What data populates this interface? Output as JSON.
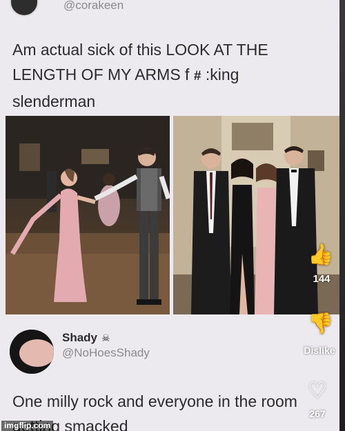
{
  "tweet1": {
    "handle": "@corakeen",
    "line1": "Am actual sick of this LOOK AT THE",
    "line2_a": "LENGTH OF MY ARMS f",
    "line2_hash": "#",
    "line2_b": ":king",
    "line3": "slenderman"
  },
  "side_actions": {
    "like_icon": "thumbs-up-icon",
    "like_count": "144",
    "dislike_icon": "thumbs-down-icon",
    "dislike_label": "Dislike",
    "heart_icon": "heart-icon",
    "heart_count": "267"
  },
  "tweet2": {
    "name": "Shady",
    "name_icon": "skull-icon",
    "handle": "@NoHoesShady",
    "line1": "One milly rock and everyone in the room",
    "line2": "getting smacked"
  },
  "watermark": "imgflip.com",
  "colors": {
    "background": "#eceaee",
    "text": "#2b2b2b",
    "handle": "#8a8a8a"
  }
}
